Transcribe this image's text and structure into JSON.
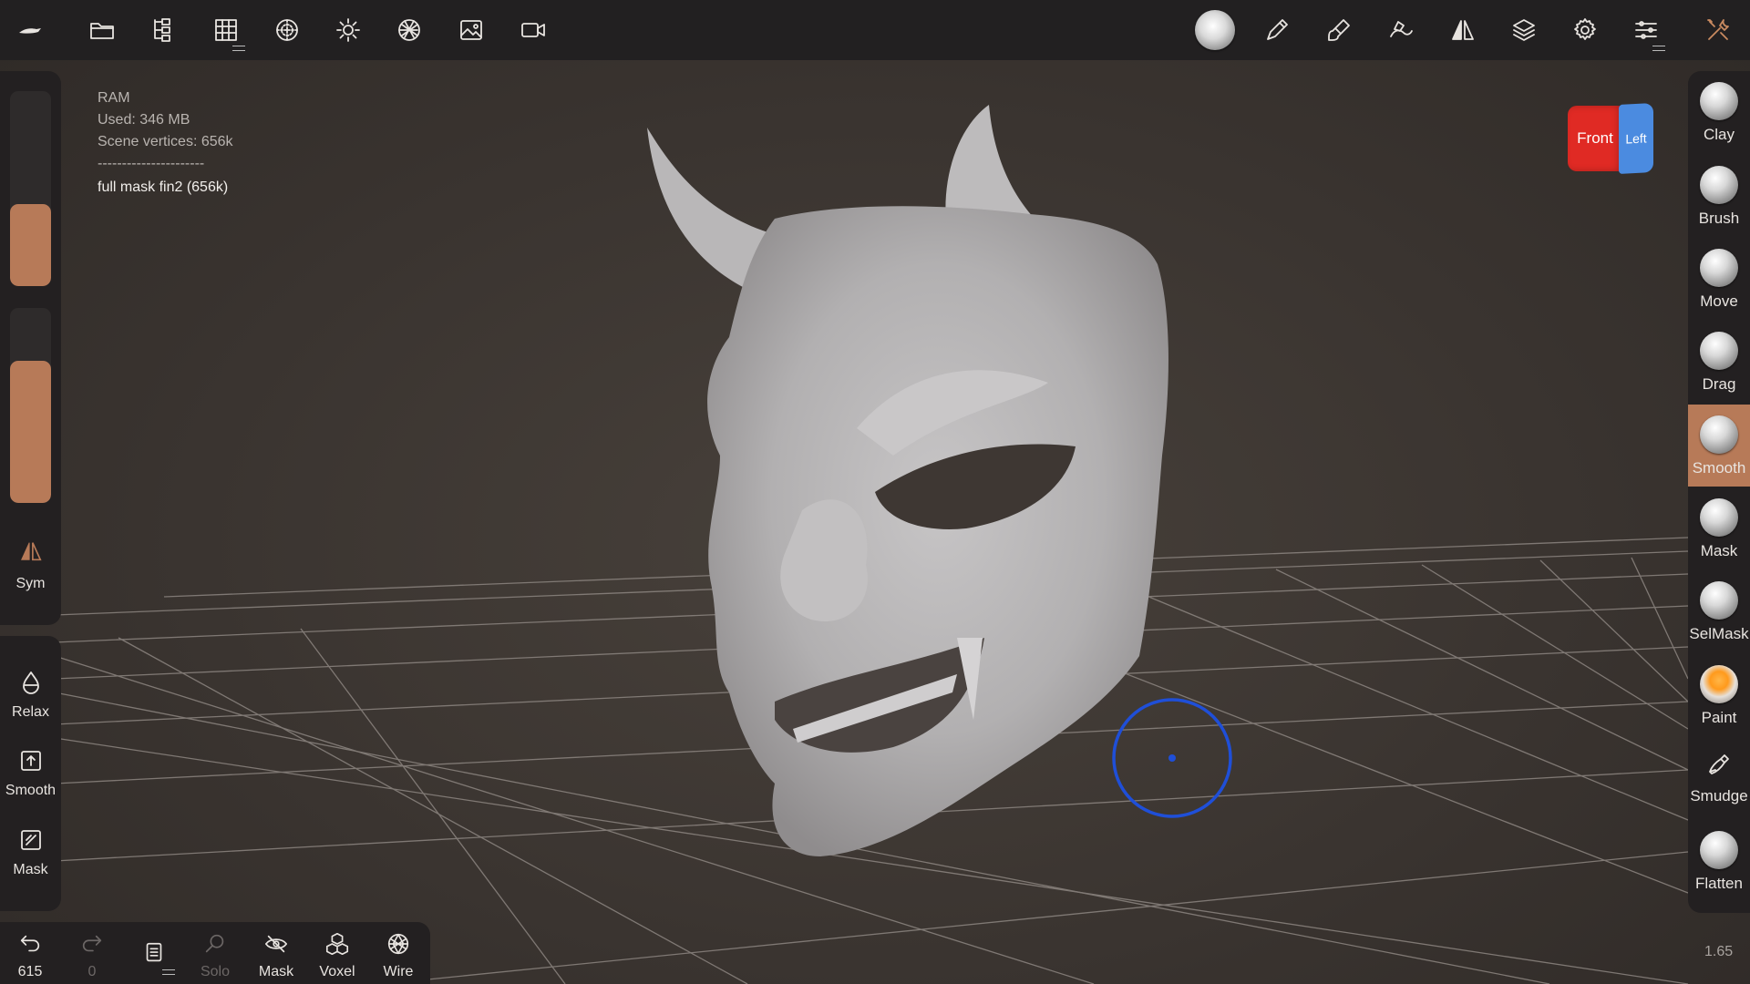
{
  "info": {
    "ram_label": "RAM",
    "used": "Used: 346 MB",
    "vertices": "Scene vertices: 656k",
    "separator": "----------------------",
    "mesh_name": "full mask fin2 (656k)"
  },
  "view_cube": {
    "front": "Front",
    "left": "Left"
  },
  "zoom": "1.65",
  "left_panel": {
    "radius_slider_level": 0.42,
    "intensity_slider_level": 0.73,
    "sym_label": "Sym"
  },
  "left_tools": {
    "relax": "Relax",
    "smooth": "Smooth",
    "mask": "Mask"
  },
  "bottom_bar": {
    "undo_count": "615",
    "redo_count": "0",
    "solo": "Solo",
    "mask": "Mask",
    "voxel": "Voxel",
    "wire": "Wire"
  },
  "right_tools": [
    {
      "label": "Clay",
      "icon": "clay-sphere"
    },
    {
      "label": "Brush",
      "icon": "brush-sphere"
    },
    {
      "label": "Move",
      "icon": "move-sphere"
    },
    {
      "label": "Drag",
      "icon": "drag-sphere"
    },
    {
      "label": "Smooth",
      "icon": "smooth-sphere",
      "active": true
    },
    {
      "label": "Mask",
      "icon": "mask-sphere"
    },
    {
      "label": "SelMask",
      "icon": "selmask-sphere"
    },
    {
      "label": "Paint",
      "icon": "paint-sphere"
    },
    {
      "label": "Smudge",
      "icon": "smudge-icon"
    },
    {
      "label": "Flatten",
      "icon": "flatten-sphere"
    }
  ],
  "colors": {
    "accent": "#b77a58",
    "panel": "#232021",
    "topbar": "#222021",
    "background": "#3a3430",
    "cursor": "#1f4fd8"
  }
}
